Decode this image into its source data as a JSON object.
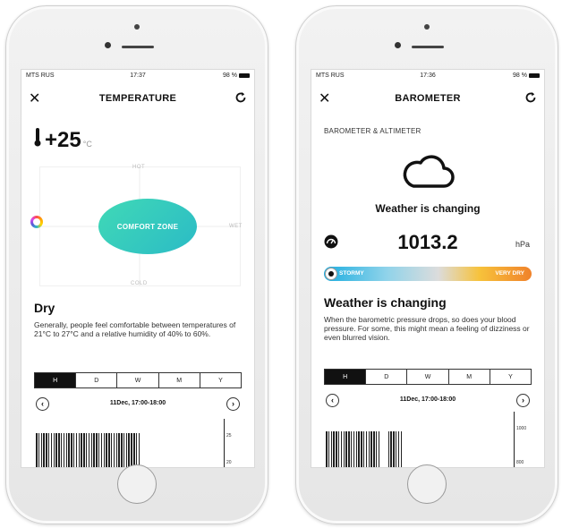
{
  "status_bar": {
    "carrier": "MTS RUS",
    "battery": "98 %",
    "time_left": "17:37",
    "time_right": "17:36"
  },
  "temperature_screen": {
    "title": "TEMPERATURE",
    "temperature": "+25",
    "unit": "°C",
    "comfort_chart": {
      "zone_label": "COMFORT ZONE",
      "axis_top": "HOT",
      "axis_bottom": "COLD",
      "axis_right": "WET"
    },
    "heading": "Dry",
    "description": "Generally, people feel comfortable between temperatures of 21°C to 27°C and a relative humidity of 40% to 60%.",
    "tabs": [
      "H",
      "D",
      "W",
      "M",
      "Y"
    ],
    "active_tab": "H",
    "range_label": "11Dec, 17:00-18:00",
    "graph_ticks": [
      "25",
      "20"
    ]
  },
  "barometer_screen": {
    "title": "BAROMETER",
    "subtitle": "BAROMETER & ALTIMETER",
    "weather_title": "Weather is changing",
    "pressure": "1013.2",
    "pressure_unit": "hPa",
    "scale_left": "STORMY",
    "scale_right": "VERY DRY",
    "heading": "Weather is changing",
    "description": "When the barometric pressure drops, so does your blood pressure. For some, this might mean a feeling of dizziness or even blurred vision.",
    "tabs": [
      "H",
      "D",
      "W",
      "M",
      "Y"
    ],
    "active_tab": "H",
    "range_label": "11Dec, 17:00-18:00",
    "graph_ticks": [
      "1000",
      "800"
    ]
  },
  "icons": {
    "close": "close-icon",
    "refresh": "refresh-icon",
    "thermometer": "thermometer-icon",
    "cloud": "cloud-icon",
    "gauge": "gauge-icon",
    "prev": "chevron-left-icon",
    "next": "chevron-right-icon"
  },
  "colors": {
    "comfort_zone": "#2bbbc6",
    "scale_start": "#1eaee0",
    "scale_end": "#f0822b",
    "active_tab": "#111111"
  }
}
